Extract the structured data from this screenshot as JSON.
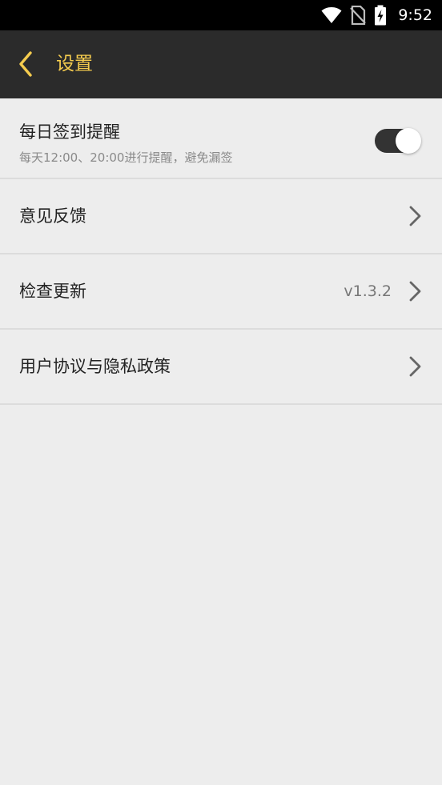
{
  "status_bar": {
    "time": "9:52",
    "icons": [
      "wifi-icon",
      "no-sim-icon",
      "battery-charging-icon"
    ]
  },
  "app_bar": {
    "title": "设置",
    "back_icon": "chevron-left-icon",
    "accent_color": "#f5cc4e"
  },
  "settings": {
    "checkin_reminder": {
      "title": "每日签到提醒",
      "subtitle": "每天12:00、20:00进行提醒，避免漏签",
      "enabled": true
    },
    "feedback": {
      "title": "意见反馈"
    },
    "check_update": {
      "title": "检查更新",
      "version": "v1.3.2"
    },
    "agreement": {
      "title": "用户协议与隐私政策"
    }
  }
}
